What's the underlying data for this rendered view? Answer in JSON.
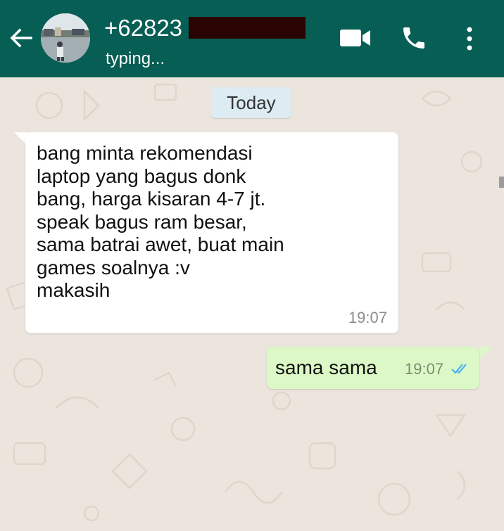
{
  "header": {
    "contact_name": "+62823",
    "status": "typing...",
    "icons": {
      "back": "arrow-left-icon",
      "video": "video-camera-icon",
      "call": "phone-icon",
      "menu": "more-vertical-icon"
    }
  },
  "chat": {
    "date_label": "Today",
    "messages": [
      {
        "direction": "incoming",
        "text": "bang minta rekomendasi\nlaptop yang bagus donk\nbang, harga kisaran 4-7 jt.\nspeak bagus ram besar,\nsama batrai awet, buat main\ngames soalnya :v\nmakasih",
        "time": "19:07"
      },
      {
        "direction": "outgoing",
        "text": "sama sama",
        "time": "19:07",
        "status_icon": "double-check-read-icon"
      }
    ]
  },
  "colors": {
    "header_bg": "#075e54",
    "wallpaper": "#ece5dd",
    "incoming_bubble": "#ffffff",
    "outgoing_bubble": "#dcf8c6",
    "date_chip": "#dcecf2",
    "read_tick": "#4fb6ec"
  }
}
